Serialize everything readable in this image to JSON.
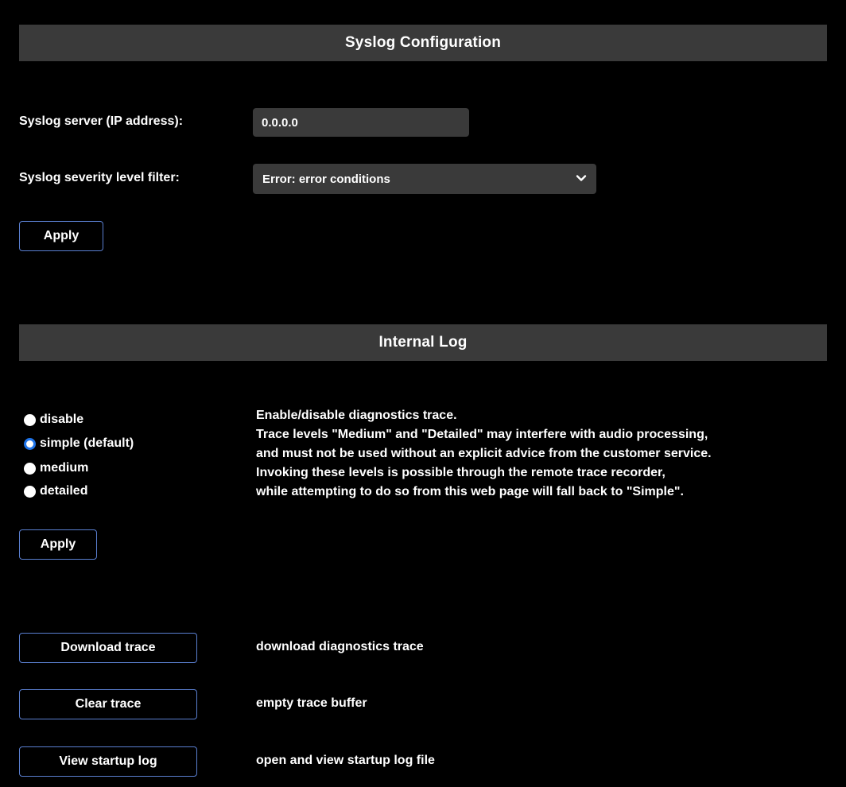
{
  "syslog": {
    "header": "Syslog Configuration",
    "server_label": "Syslog server (IP address):",
    "server_value": "0.0.0.0",
    "severity_label": "Syslog severity level filter:",
    "severity_selected": "Error: error conditions",
    "apply_label": "Apply"
  },
  "internal_log": {
    "header": "Internal Log",
    "options": [
      {
        "label": "disable",
        "checked": false
      },
      {
        "label": "simple (default)",
        "checked": true
      },
      {
        "label": "medium",
        "checked": false
      },
      {
        "label": "detailed",
        "checked": false
      }
    ],
    "description": [
      "Enable/disable diagnostics trace.",
      "Trace levels \"Medium\" and \"Detailed\" may interfere with audio processing,",
      "and must not be used without an explicit advice from the customer service.",
      "Invoking these levels is possible through the remote trace recorder,",
      "while attempting to do so from this web page will fall back to \"Simple\"."
    ],
    "apply_label": "Apply"
  },
  "actions": [
    {
      "button": "Download trace",
      "description": "download diagnostics trace"
    },
    {
      "button": "Clear trace",
      "description": "empty trace buffer"
    },
    {
      "button": "View startup log",
      "description": "open and view startup log file"
    }
  ],
  "colors": {
    "background": "#000000",
    "header_bg": "#3a3a3a",
    "button_border": "#5a7fd0",
    "radio_accent": "#1e73e8"
  }
}
